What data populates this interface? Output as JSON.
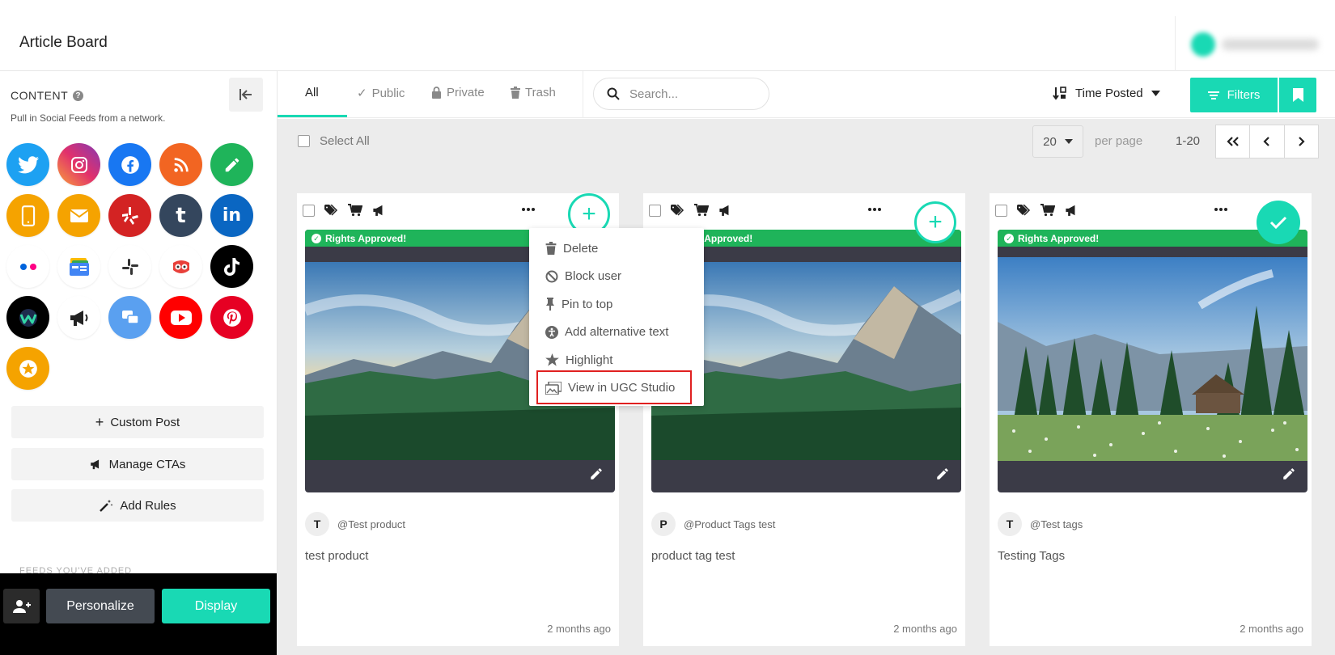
{
  "header": {
    "title": "Article Board"
  },
  "sidebar": {
    "heading": "CONTENT",
    "help": "?",
    "subtitle": "Pull in Social Feeds from a network.",
    "networks": [
      {
        "name": "twitter",
        "color": "#1da1f2"
      },
      {
        "name": "instagram",
        "color": "#d6249f"
      },
      {
        "name": "facebook",
        "color": "#1877f2"
      },
      {
        "name": "rss",
        "color": "#f26522"
      },
      {
        "name": "custom-pencil",
        "color": "#1fb45a"
      },
      {
        "name": "mobile",
        "color": "#f5a300"
      },
      {
        "name": "email",
        "color": "#f5a300"
      },
      {
        "name": "yelp",
        "color": "#d32323"
      },
      {
        "name": "tumblr",
        "color": "#34465d"
      },
      {
        "name": "linkedin",
        "color": "#0a66c2"
      },
      {
        "name": "flickr",
        "color": "#ffffff"
      },
      {
        "name": "google-news",
        "color": "#ffffff"
      },
      {
        "name": "slack",
        "color": "#ffffff"
      },
      {
        "name": "tripadvisor-owl",
        "color": "#ffffff"
      },
      {
        "name": "tiktok",
        "color": "#000000"
      },
      {
        "name": "webex",
        "color": "#000000"
      },
      {
        "name": "megaphone",
        "color": "#ffffff"
      },
      {
        "name": "chat",
        "color": "#5aa0f0"
      },
      {
        "name": "youtube",
        "color": "#ff0000"
      },
      {
        "name": "pinterest",
        "color": "#e60023"
      },
      {
        "name": "star",
        "color": "#f5a300"
      }
    ],
    "buttons": {
      "custom_post": "Custom Post",
      "manage_ctas": "Manage CTAs",
      "add_rules": "Add Rules"
    },
    "feeds_added": "FEEDS YOU'VE ADDED",
    "footer": {
      "personalize": "Personalize",
      "display": "Display"
    }
  },
  "toolbar": {
    "tabs": [
      {
        "label": "All"
      },
      {
        "label": "Public"
      },
      {
        "label": "Private"
      },
      {
        "label": "Trash"
      }
    ],
    "search": {
      "placeholder": "Search..."
    },
    "sort": {
      "label": "Time Posted"
    },
    "filters_label": "Filters"
  },
  "selectbar": {
    "select_all": "Select All",
    "per_page_value": "20",
    "per_page_label": "per page",
    "range": "1-20"
  },
  "cards": [
    {
      "rights": "Rights Approved!",
      "avatar": "T",
      "handle": "@Test product",
      "caption": "test product",
      "time": "2 months ago",
      "action": "add"
    },
    {
      "rights": "Rights Approved!",
      "avatar": "P",
      "handle": "@Product Tags test",
      "caption": "product tag test",
      "time": "2 months ago",
      "action": "add"
    },
    {
      "rights": "Rights Approved!",
      "avatar": "T",
      "handle": "@Test tags",
      "caption": "Testing Tags",
      "time": "2 months ago",
      "action": "approved"
    }
  ],
  "context_menu": {
    "items": [
      {
        "label": "Delete",
        "icon": "trash-icon"
      },
      {
        "label": "Block user",
        "icon": "block-icon"
      },
      {
        "label": "Pin to top",
        "icon": "pin-icon"
      },
      {
        "label": "Add alternative text",
        "icon": "accessibility-icon"
      },
      {
        "label": "Highlight",
        "icon": "star-icon"
      },
      {
        "label": "View in UGC Studio",
        "icon": "gallery-icon",
        "highlighted": true
      }
    ]
  },
  "colors": {
    "accent": "#19d9b4",
    "rights": "#1fb45a",
    "highlight_border": "#e02020"
  }
}
